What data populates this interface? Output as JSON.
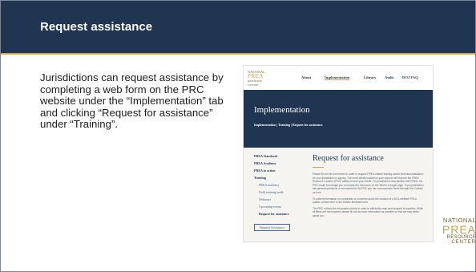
{
  "slide": {
    "title": "Request assistance",
    "body_text": "Jurisdictions can request assistance by completing a web form on the PRC website under the “Implementation” tab and clicking “Request for assistance” under “Training”."
  },
  "screenshot": {
    "logo": {
      "line1": "NATIONAL",
      "line2": "PREA",
      "line3": "RESOURCE",
      "line4": "CENTER"
    },
    "nav": [
      "About",
      "Implementation",
      "Library",
      "Audit",
      "DOJ FAQ"
    ],
    "active_nav": "Implementation",
    "hero_title": "Implementation",
    "hero_crumbs": "Implementation | Training | Request for assistance",
    "sidebar": {
      "items": [
        {
          "label": "PREA Standards",
          "sub": false
        },
        {
          "label": "PREA Academy",
          "sub": false
        },
        {
          "label": "PREA in action",
          "sub": false
        },
        {
          "label": "Training",
          "sub": false
        },
        {
          "label": "PREA academy",
          "sub": true
        },
        {
          "label": "Field training audit",
          "sub": true
        },
        {
          "label": "Webinars",
          "sub": true
        },
        {
          "label": "Upcoming events",
          "sub": true
        },
        {
          "label": "Request for assistance",
          "sub": true,
          "current": true
        }
      ],
      "button": "Request Assistance"
    },
    "main_title": "Request for assistance",
    "paragraphs": [
      "Please fill out the form below in order to request PREA-related training and/or technical assistance for your jurisdiction or agency. The more detail provided in your request will improve the PREA Resource Center's (PRC) ability to meet your needs. For jurisdictions less familiar with PREA, the PRC would encourage you to browse the resources on the Where to begin page. If you jurisdiction has general questions or comments for the PRC you can communicate those through the Contact us form.",
      "To submit information on complaints or concerns about the conduct of a DOJ-certified PREA auditor, please refer to the Auditor feedback form.",
      "The PRC collects the information below in order to efficiently route and respond to inquiries. While all fields are not required, please fill out as much information as possible so that we may better assist you."
    ]
  },
  "footer_logo": {
    "line1": "NATIONAL",
    "line2": "PREA",
    "line3": "RESOURCE",
    "line4": "CENTER"
  }
}
